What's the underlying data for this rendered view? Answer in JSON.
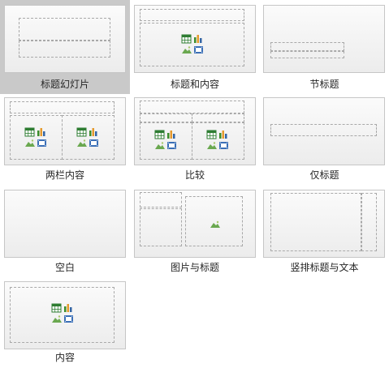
{
  "layouts": [
    {
      "label": "标题幻灯片",
      "selected": true
    },
    {
      "label": "标题和内容",
      "selected": false
    },
    {
      "label": "节标题",
      "selected": false
    },
    {
      "label": "两栏内容",
      "selected": false
    },
    {
      "label": "比较",
      "selected": false
    },
    {
      "label": "仅标题",
      "selected": false
    },
    {
      "label": "空白",
      "selected": false
    },
    {
      "label": "图片与标题",
      "selected": false
    },
    {
      "label": "竖排标题与文本",
      "selected": false
    },
    {
      "label": "内容",
      "selected": false
    }
  ],
  "icons": {
    "content": "content-placeholder-icon",
    "picture": "picture-icon"
  },
  "colors": {
    "selection": "#c9c9c9",
    "table_icon": "#2e7d32",
    "chart_bars": [
      "#3a8d2a",
      "#e59a2c",
      "#3465a4"
    ],
    "picture_green": "#6aa84f",
    "video_blue": "#3b6fb6"
  }
}
